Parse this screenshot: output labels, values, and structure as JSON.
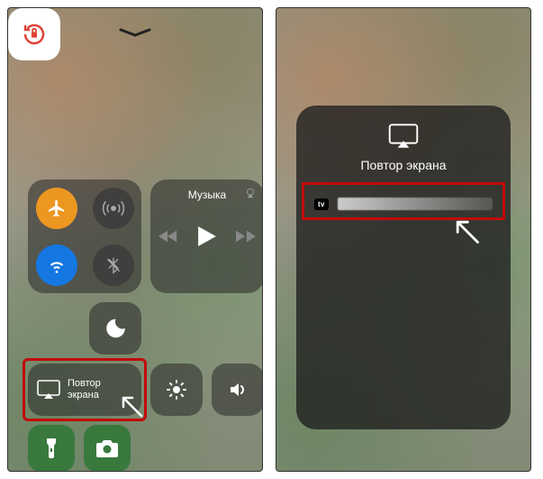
{
  "screen1": {
    "music": {
      "title": "Музыка"
    },
    "mirror": {
      "line1": "Повтор",
      "line2": "экрана"
    }
  },
  "screen2": {
    "modal": {
      "title": "Повтор экрана",
      "device_badge": "tv"
    }
  },
  "colors": {
    "accent_orange": "#ff9500",
    "accent_blue": "#007aff",
    "highlight": "#e60000"
  }
}
